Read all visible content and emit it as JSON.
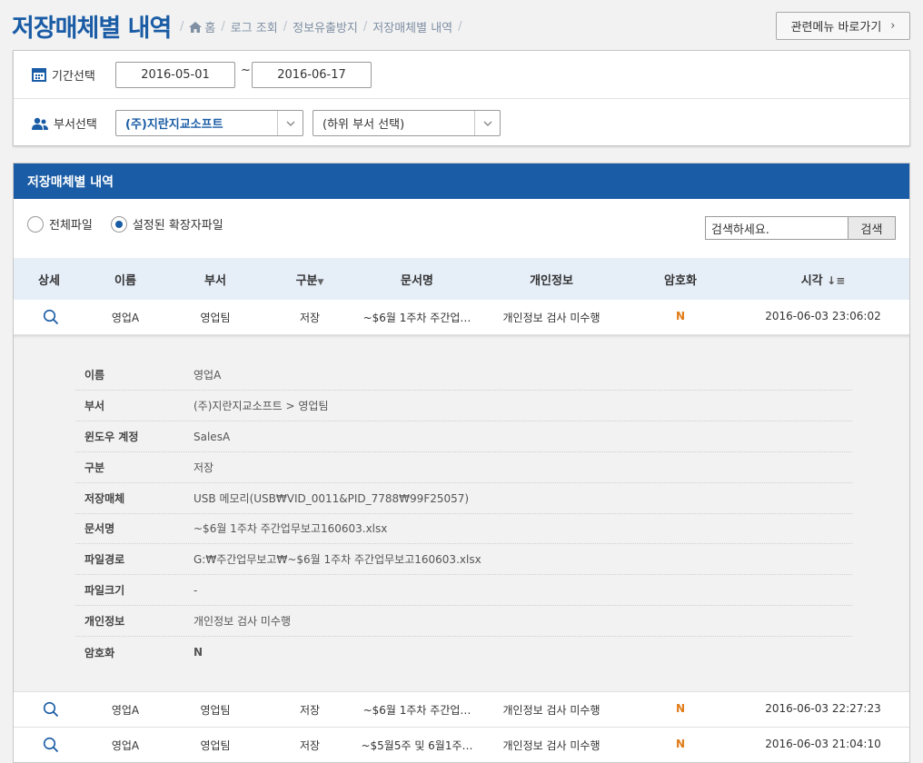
{
  "page": {
    "title": "저장매체별 내역",
    "breadcrumb": [
      "홈",
      "로그 조회",
      "정보유출방지",
      "저장매체별 내역"
    ],
    "related_menu_label": "관련메뉴 바로가기"
  },
  "filter": {
    "period_label": "기간선택",
    "date_from": "2016-05-01",
    "date_to": "2016-06-17",
    "date_sep": "~",
    "dept_label": "부서선택",
    "dept_value": "(주)지란지교소프트",
    "subdept_value": "(하위 부서 선택)"
  },
  "panel": {
    "title": "저장매체별 내역",
    "radio_all": "전체파일",
    "radio_ext": "설정된 확장자파일",
    "search_placeholder": "검색하세요.",
    "search_button": "검색"
  },
  "table": {
    "headers": [
      "상세",
      "이름",
      "부서",
      "구분",
      "문서명",
      "개인정보",
      "암호화",
      "시각"
    ],
    "rows": [
      {
        "name": "영업A",
        "dept": "영업팀",
        "type": "저장",
        "doc": "~$6월 1주차 주간업…",
        "privacy": "개인정보 검사 미수행",
        "enc": "N",
        "time": "2016-06-03 23:06:02"
      },
      {
        "name": "영업A",
        "dept": "영업팀",
        "type": "저장",
        "doc": "~$6월 1주차 주간업…",
        "privacy": "개인정보 검사 미수행",
        "enc": "N",
        "time": "2016-06-03 22:27:23"
      },
      {
        "name": "영업A",
        "dept": "영업팀",
        "type": "저장",
        "doc": "~$5월5주 및 6월1주…",
        "privacy": "개인정보 검사 미수행",
        "enc": "N",
        "time": "2016-06-03 21:04:10"
      }
    ]
  },
  "detail": [
    {
      "key": "이름",
      "value": "영업A"
    },
    {
      "key": "부서",
      "value": "(주)지란지교소프트 > 영업팀"
    },
    {
      "key": "윈도우 계정",
      "value": "SalesA"
    },
    {
      "key": "구분",
      "value": "저장"
    },
    {
      "key": "저장매체",
      "value": "USB 메모리(USB₩VID_0011&PID_7788₩99F25057)"
    },
    {
      "key": "문서명",
      "value": "~$6월 1주차 주간업무보고160603.xlsx"
    },
    {
      "key": "파일경로",
      "value": "G:₩주간업무보고₩~$6월 1주차 주간업무보고160603.xlsx"
    },
    {
      "key": "파일크기",
      "value": "-"
    },
    {
      "key": "개인정보",
      "value": "개인정보 검사 미수행"
    },
    {
      "key": "암호화",
      "value": "N"
    }
  ]
}
